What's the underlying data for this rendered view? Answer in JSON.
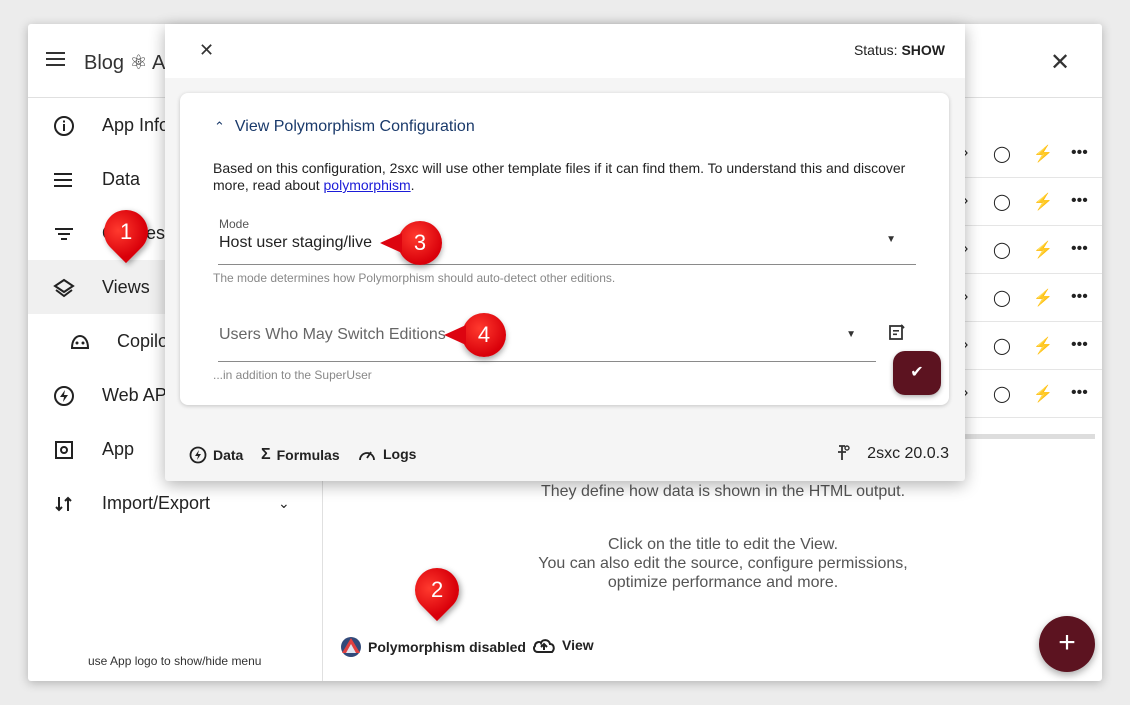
{
  "app": {
    "title": "Blog ⚛ A",
    "close_label": "✕"
  },
  "sidebar": {
    "items": [
      {
        "label": "App Info",
        "icon": "info-icon"
      },
      {
        "label": "Data",
        "icon": "list-icon"
      },
      {
        "label": "Queries",
        "icon": "filter-icon"
      },
      {
        "label": "Views",
        "icon": "layers-icon"
      },
      {
        "label": "Copilot",
        "icon": "copilot-icon"
      },
      {
        "label": "Web API",
        "icon": "bolt-icon"
      },
      {
        "label": "App",
        "icon": "settings-box-icon"
      },
      {
        "label": "Import/Export",
        "icon": "import-export-icon"
      }
    ],
    "footer_hint": "use App logo to show/hide menu"
  },
  "main": {
    "text1": "They define how data is shown in the HTML output.",
    "text2": "Click on the title to edit the View.",
    "text3": "You can also edit the source, configure permissions, optimize performance and more.",
    "polymorphism_link": "Polymorphism disabled",
    "view_link": "View",
    "fab_label": "+"
  },
  "dialog": {
    "close_label": "✕",
    "status_label": "Status:",
    "status_value": "SHOW",
    "section_title": "View Polymorphism Configuration",
    "description_prefix": "Based on this configuration, 2sxc will use other template files if it can find them. To understand this and discover more, read about ",
    "description_link": "polymorphism",
    "description_suffix": ".",
    "mode_label": "Mode",
    "mode_value": "Host user staging/live",
    "mode_hint": "The mode determines how Polymorphism should auto-detect other editions.",
    "users_placeholder": "Users Who May Switch Editions",
    "users_hint": "...in addition to the SuperUser",
    "footer": {
      "data_label": "Data",
      "formulas_label": "Formulas",
      "logs_label": "Logs",
      "version": "2sxc 20.0.3"
    }
  },
  "markers": [
    "1",
    "2",
    "3",
    "4"
  ],
  "colors": {
    "accent": "#5c1320",
    "marker": "#dd0410",
    "link": "#1b1bd8",
    "heading": "#1a3a6b"
  }
}
